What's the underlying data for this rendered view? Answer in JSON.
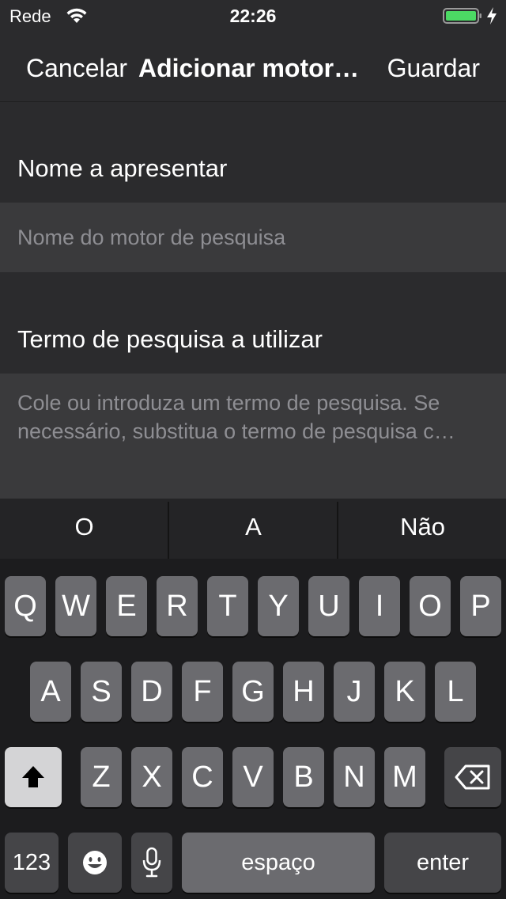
{
  "status": {
    "carrier": "Rede",
    "time": "22:26"
  },
  "nav": {
    "cancel": "Cancelar",
    "title": "Adicionar motor…",
    "save": "Guardar"
  },
  "form": {
    "name_label": "Nome a apresentar",
    "name_placeholder": "Nome do motor de pesquisa",
    "term_label": "Termo de pesquisa a utilizar",
    "term_placeholder_line1": "Cole ou introduza um termo de pesquisa. Se",
    "term_placeholder_line2": "necessário, substitua o termo de pesquisa c…"
  },
  "keyboard": {
    "predictions": [
      "O",
      "A",
      "Não"
    ],
    "row1": [
      "Q",
      "W",
      "E",
      "R",
      "T",
      "Y",
      "U",
      "I",
      "O",
      "P"
    ],
    "row2": [
      "A",
      "S",
      "D",
      "F",
      "G",
      "H",
      "J",
      "K",
      "L"
    ],
    "row3": [
      "Z",
      "X",
      "C",
      "V",
      "B",
      "N",
      "M"
    ],
    "numbers": "123",
    "space": "espaço",
    "enter": "enter"
  }
}
